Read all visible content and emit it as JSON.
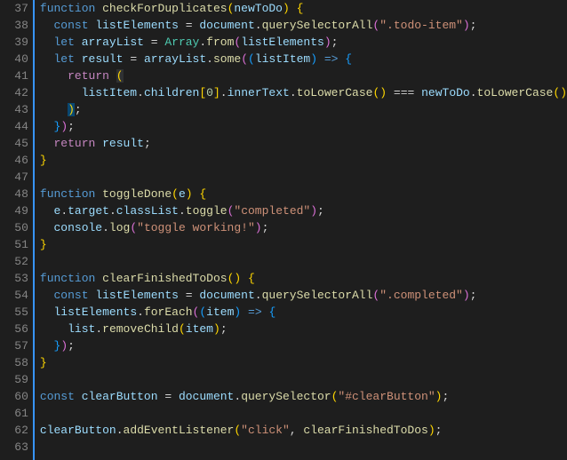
{
  "lineStart": 37,
  "lineEnd": 63,
  "tokens": {
    "function": "function",
    "const": "const",
    "let": "let",
    "return": "return",
    "checkForDuplicates": "checkForDuplicates",
    "newToDo": "newToDo",
    "listElements": "listElements",
    "document": "document",
    "querySelectorAll": "querySelectorAll",
    "todoItemStr": "\".todo-item\"",
    "arrayList": "arrayList",
    "Array": "Array",
    "from": "from",
    "result": "result",
    "some": "some",
    "listItem": "listItem",
    "arrow": "=>",
    "children": "children",
    "zero": "0",
    "innerText": "innerText",
    "toLowerCase": "toLowerCase",
    "eqeqeq": "===",
    "toggleDone": "toggleDone",
    "e": "e",
    "target": "target",
    "classList": "classList",
    "toggle": "toggle",
    "completedStr": "\"completed\"",
    "console": "console",
    "log": "log",
    "toggleWorkingStr": "\"toggle working!\"",
    "clearFinishedToDos": "clearFinishedToDos",
    "completedSelStr": "\".completed\"",
    "forEach": "forEach",
    "item": "item",
    "list": "list",
    "removeChild": "removeChild",
    "clearButton": "clearButton",
    "querySelector": "querySelector",
    "clearButtonSelStr": "\"#clearButton\"",
    "addEventListener": "addEventListener",
    "clickStr": "\"click\""
  }
}
